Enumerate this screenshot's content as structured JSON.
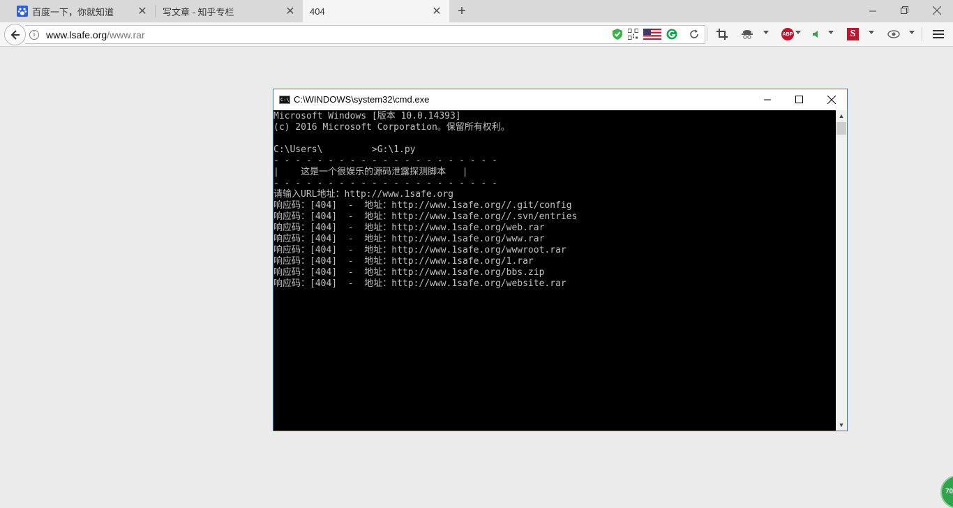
{
  "tabs": [
    {
      "title": "百度一下，你就知道",
      "icon": "baidu-paw-icon"
    },
    {
      "title": "写文章 - 知乎专栏",
      "icon": "blank-page-icon"
    },
    {
      "title": "404",
      "icon": "blank-page-icon",
      "active": true
    }
  ],
  "address": {
    "host": "www.lsafe.org",
    "path": "/www.rar"
  },
  "extensions": [
    "shield-check-icon",
    "qr-code-icon",
    "us-flag-icon",
    "grammarly-icon",
    "reload-icon",
    "crop-icon",
    "spy-icon",
    "adblock-plus-icon",
    "audio-icon",
    "s-extension-icon",
    "eye-extension-icon",
    "menu-icon"
  ],
  "adblock_label": "ABP",
  "s_ext_label": "S",
  "cmd": {
    "title": "C:\\WINDOWS\\system32\\cmd.exe",
    "icon_label": "C:\\",
    "lines": [
      "Microsoft Windows [版本 10.0.14393]",
      "(c) 2016 Microsoft Corporation。保留所有权利。",
      "",
      "C:\\Users\\         >G:\\1.py",
      "- - - - - - - - - - - - - - - - - - - - -",
      "|    这是一个很娱乐的源码泄露探测脚本   |",
      "- - - - - - - - - - - - - - - - - - - - -",
      "请输入URL地址：http://www.1safe.org",
      "响应码：[404]  -  地址：http://www.1safe.org//.git/config",
      "响应码：[404]  -  地址：http://www.1safe.org//.svn/entries",
      "响应码：[404]  -  地址：http://www.1safe.org/web.rar",
      "响应码：[404]  -  地址：http://www.1safe.org/www.rar",
      "响应码：[404]  -  地址：http://www.1safe.org/wwwroot.rar",
      "响应码：[404]  -  地址：http://www.1safe.org/1.rar",
      "响应码：[404]  -  地址：http://www.1safe.org/bbs.zip",
      "响应码：[404]  -  地址：http://www.1safe.org/website.rar"
    ]
  },
  "badge": {
    "value": "70"
  }
}
